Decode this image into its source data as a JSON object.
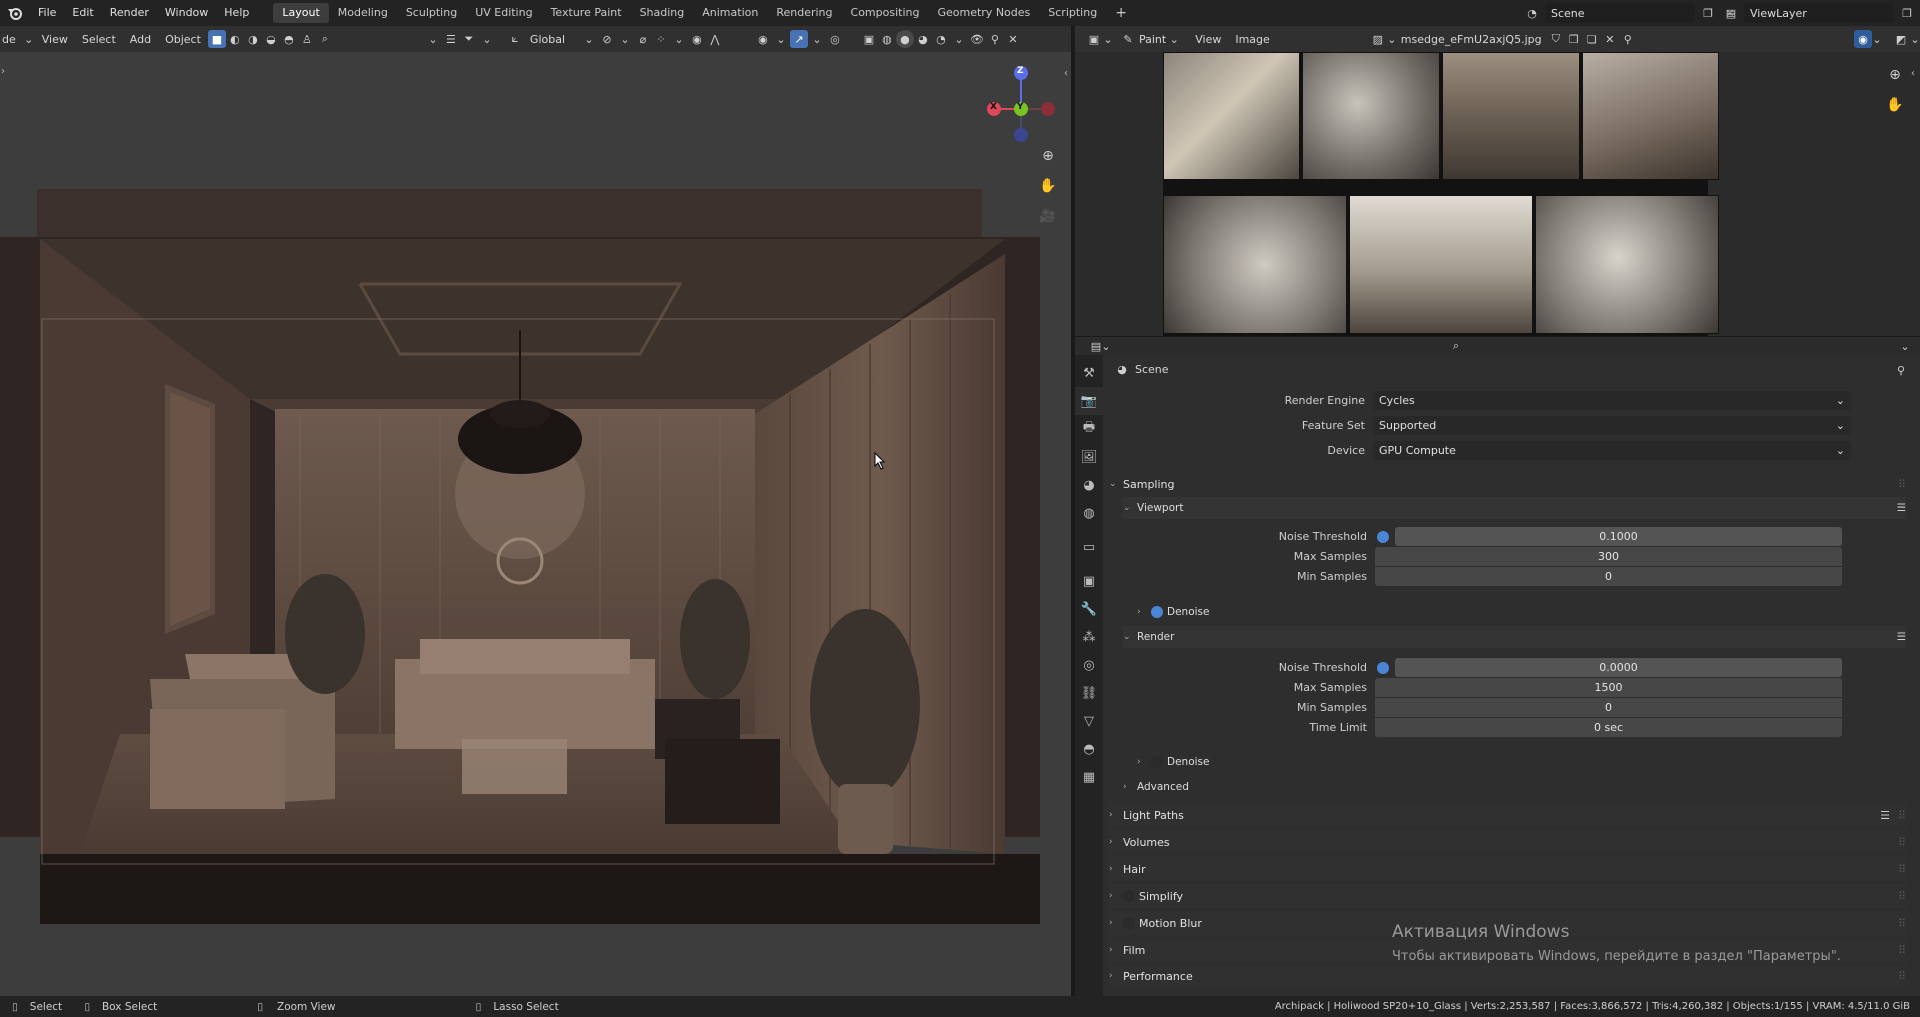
{
  "topbar": {
    "menus": [
      "File",
      "Edit",
      "Render",
      "Window",
      "Help"
    ],
    "workspaces": [
      "Layout",
      "Modeling",
      "Sculpting",
      "UV Editing",
      "Texture Paint",
      "Shading",
      "Animation",
      "Rendering",
      "Compositing",
      "Geometry Nodes",
      "Scripting"
    ],
    "active_workspace": "Layout",
    "add_tab": "+",
    "scene": "Scene",
    "view_layer": "ViewLayer"
  },
  "viewport": {
    "mode": "de",
    "menus": [
      "View",
      "Select",
      "Add",
      "Object"
    ],
    "orientation": "Global",
    "gizmo": {
      "x": "X",
      "y": "Y",
      "z": "Z"
    }
  },
  "image_editor": {
    "mode": "Paint",
    "menus": [
      "View",
      "Image"
    ],
    "image_name": "msedge_eFmU2axjQ5.jpg"
  },
  "properties": {
    "breadcrumb": "Scene",
    "render_engine_label": "Render Engine",
    "render_engine": "Cycles",
    "feature_set_label": "Feature Set",
    "feature_set": "Supported",
    "device_label": "Device",
    "device": "GPU Compute",
    "sampling": {
      "title": "Sampling",
      "viewport": {
        "title": "Viewport",
        "noise_threshold_label": "Noise Threshold",
        "noise_threshold": "0.1000",
        "max_samples_label": "Max Samples",
        "max_samples": "300",
        "min_samples_label": "Min Samples",
        "min_samples": "0",
        "denoise": "Denoise"
      },
      "render": {
        "title": "Render",
        "noise_threshold_label": "Noise Threshold",
        "noise_threshold": "0.0000",
        "max_samples_label": "Max Samples",
        "max_samples": "1500",
        "min_samples_label": "Min Samples",
        "min_samples": "0",
        "time_limit_label": "Time Limit",
        "time_limit": "0 sec",
        "denoise": "Denoise"
      },
      "advanced": "Advanced"
    },
    "panels": [
      "Light Paths",
      "Volumes",
      "Hair",
      "Simplify",
      "Motion Blur",
      "Film",
      "Performance"
    ]
  },
  "watermark": {
    "title": "Активация Windows",
    "text": "Чтобы активировать Windows, перейдите в раздел \"Параметры\"."
  },
  "statusbar": {
    "select": "Select",
    "box_select": "Box Select",
    "zoom_view": "Zoom View",
    "lasso_select": "Lasso Select",
    "stats": "Archipack | Holiwood SP20+10_Glass | Verts:2,253,587 | Faces:3,866,572 | Tris:4,260,382 | Objects:1/155 | VRAM: 4.5/11.0 GiB"
  },
  "colors": {
    "accent": "#4772b3",
    "axis_x": "#e0475a",
    "axis_y": "#79c221",
    "axis_z": "#5b6ee8"
  }
}
